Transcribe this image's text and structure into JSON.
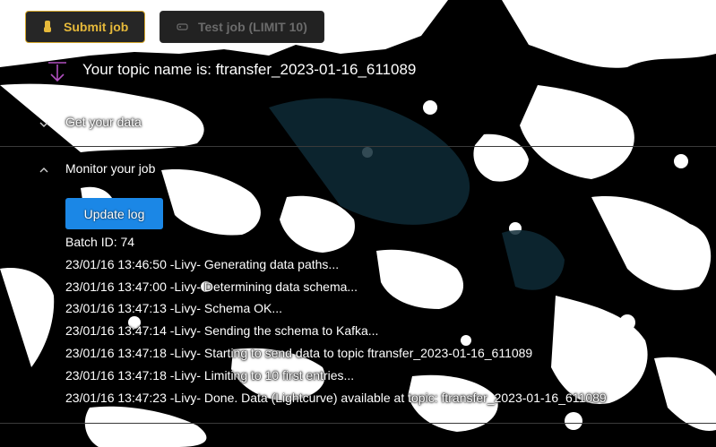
{
  "toolbar": {
    "submit_label": "Submit job",
    "submit_icon": "hand-icon",
    "test_label": "Test job (LIMIT 10)",
    "test_icon": "tag-icon"
  },
  "topic": {
    "text": "Your topic name is: ftransfer_2023-01-16_611089",
    "icon": "download-arrow-icon"
  },
  "sections": {
    "get_data": {
      "label": "Get your data",
      "expanded": false
    },
    "monitor": {
      "label": "Monitor your job",
      "expanded": true
    }
  },
  "monitor": {
    "update_label": "Update log",
    "batch_id": "Batch ID: 74",
    "log_lines": [
      "23/01/16 13:46:50 -Livy- Generating data paths...",
      "23/01/16 13:47:00 -Livy- Determining data schema...",
      "23/01/16 13:47:13 -Livy- Schema OK...",
      "23/01/16 13:47:14 -Livy- Sending the schema to Kafka...",
      "23/01/16 13:47:18 -Livy- Starting to send data to topic ftransfer_2023-01-16_611089",
      "23/01/16 13:47:18 -Livy- Limiting to 10 first entries...",
      "23/01/16 13:47:23 -Livy- Done. Data (Lightcurve) available at topic: ftransfer_2023-01-16_611089"
    ]
  },
  "colors": {
    "accent_gold": "#d4a62a",
    "primary_blue": "#1b87e6",
    "disabled_bg": "#222222",
    "accent_purple": "#b04fbf",
    "background_dark": "#0a1a22"
  }
}
